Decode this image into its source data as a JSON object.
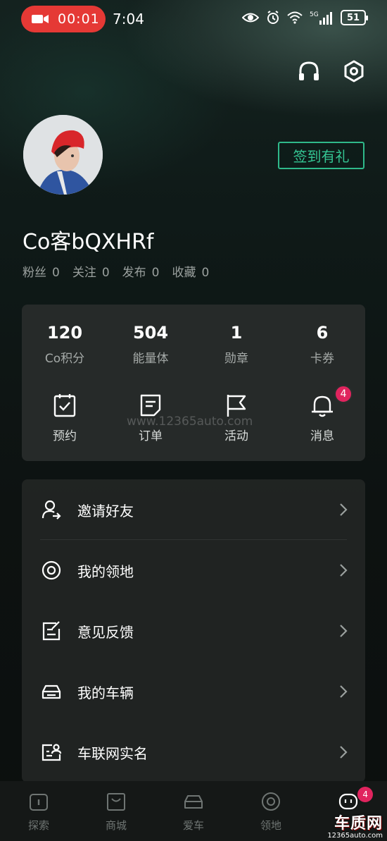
{
  "status_bar": {
    "record_time": "00:01",
    "clock": "7:04",
    "network": "5G",
    "battery": "51"
  },
  "profile": {
    "checkin_label": "签到有礼",
    "username": "Co客bQXHRf",
    "social": [
      {
        "label": "粉丝",
        "value": "0"
      },
      {
        "label": "关注",
        "value": "0"
      },
      {
        "label": "发布",
        "value": "0"
      },
      {
        "label": "收藏",
        "value": "0"
      }
    ]
  },
  "stats": [
    {
      "value": "120",
      "label": "Co积分"
    },
    {
      "value": "504",
      "label": "能量体"
    },
    {
      "value": "1",
      "label": "勋章"
    },
    {
      "value": "6",
      "label": "卡券"
    }
  ],
  "actions": [
    {
      "label": "预约",
      "icon": "calendar-check-icon"
    },
    {
      "label": "订单",
      "icon": "order-doc-icon"
    },
    {
      "label": "活动",
      "icon": "flag-icon"
    },
    {
      "label": "消息",
      "icon": "bell-icon",
      "badge": "4"
    }
  ],
  "watermark": "www.12365auto.com",
  "menu": [
    {
      "label": "邀请好友",
      "icon": "invite-user-icon"
    },
    {
      "label": "我的领地",
      "icon": "territory-icon"
    },
    {
      "label": "意见反馈",
      "icon": "feedback-icon"
    },
    {
      "label": "我的车辆",
      "icon": "car-icon"
    },
    {
      "label": "车联网实名",
      "icon": "id-card-icon"
    }
  ],
  "bottom_nav": [
    {
      "label": "探索",
      "icon": "explore-icon"
    },
    {
      "label": "商城",
      "icon": "shop-icon"
    },
    {
      "label": "爱车",
      "icon": "car-icon"
    },
    {
      "label": "领地",
      "icon": "territory-icon"
    },
    {
      "label": "",
      "icon": "chat-icon",
      "badge": "4"
    }
  ],
  "corner_logo": {
    "brand": "车质网",
    "site": "12365auto.com"
  },
  "colors": {
    "accent": "#34c593",
    "badge": "#e0245e",
    "record": "#e53935"
  }
}
